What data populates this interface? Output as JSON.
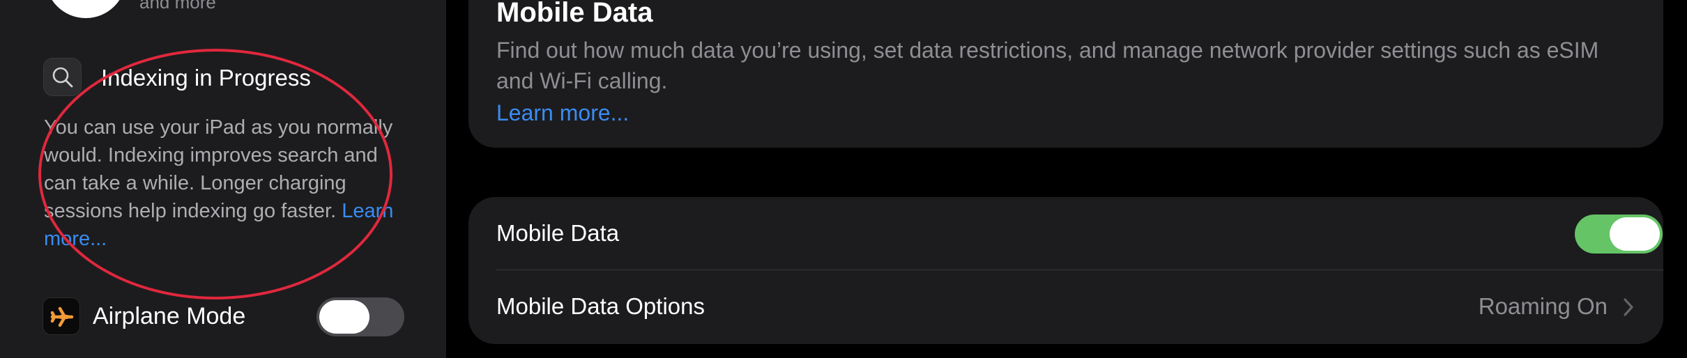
{
  "sidebar": {
    "account_subtitle": "and more",
    "indexing": {
      "icon": "search-icon",
      "title": "Indexing in Progress",
      "description": "You can use your iPad as you normally would. Indexing improves search and can take a while. Longer charging sessions help indexing go faster.",
      "link": "Learn more..."
    },
    "airplane": {
      "icon": "airplane-icon",
      "label": "Airplane Mode",
      "enabled": false,
      "icon_color": "#f29b38"
    }
  },
  "main": {
    "info_card": {
      "title": "Mobile Data",
      "description": "Find out how much data you’re using, set data restrictions, and manage network provider settings such as eSIM and Wi-Fi calling.",
      "link": "Learn more..."
    },
    "settings": [
      {
        "label": "Mobile Data",
        "toggle": true
      },
      {
        "label": "Mobile Data Options",
        "value": "Roaming On"
      }
    ]
  },
  "colors": {
    "accent_link": "#3a8cf2",
    "toggle_on": "#65c466",
    "annotation_circle": "#e0283d"
  }
}
